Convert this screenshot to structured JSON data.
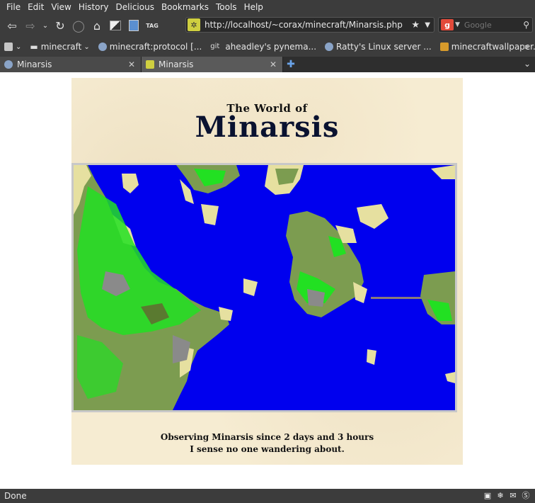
{
  "menu": [
    "File",
    "Edit",
    "View",
    "History",
    "Delicious",
    "Bookmarks",
    "Tools",
    "Help"
  ],
  "nav": {
    "url": "http://localhost/~corax/minecraft/Minarsis.php",
    "search_placeholder": "Google",
    "tag_label": "TAG"
  },
  "bookmarks": [
    {
      "label": "minecraft",
      "icon": "folder-icon"
    },
    {
      "label": "minecraft:protocol [...",
      "icon": "globe-icon"
    },
    {
      "label": "aheadley's pynema...",
      "icon": "git-icon"
    },
    {
      "label": "Ratty's Linux server ...",
      "icon": "globe-icon"
    },
    {
      "label": "minecraftwallpaper....",
      "icon": "minecraft-icon"
    }
  ],
  "tabs": [
    {
      "label": "Minarsis",
      "active": false
    },
    {
      "label": "Minarsis",
      "active": true
    }
  ],
  "page": {
    "title_small": "The World of",
    "title_big": "Minarsis",
    "caption_line1": "Observing Minarsis since 2 days and 3 hours",
    "caption_line2": "I sense no one wandering about."
  },
  "status": {
    "text": "Done"
  },
  "colors": {
    "water": "#0000ee",
    "grass": "#7c9c50",
    "trees": "#22e022",
    "sand": "#e6e0a0",
    "stone": "#8a8a8a",
    "parchment": "#f6ecd2",
    "chrome": "#3c3c3c"
  }
}
